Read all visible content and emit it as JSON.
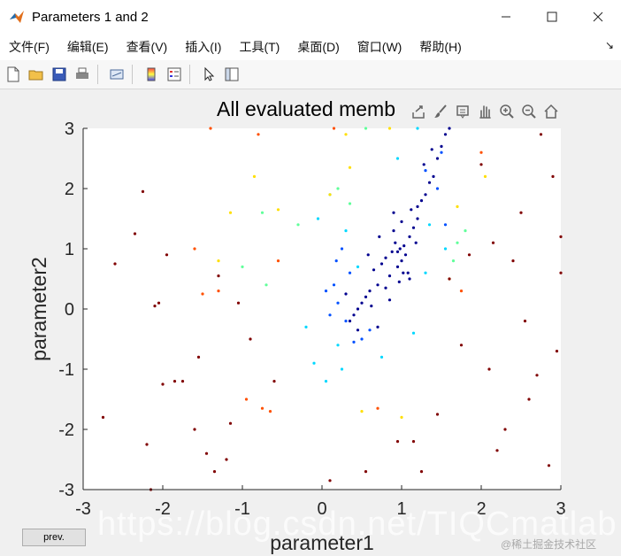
{
  "window": {
    "title": "Parameters 1 and 2",
    "buttons": [
      "minimize",
      "maximize",
      "close"
    ]
  },
  "menubar": {
    "items": [
      "文件(F)",
      "编辑(E)",
      "查看(V)",
      "插入(I)",
      "工具(T)",
      "桌面(D)",
      "窗口(W)",
      "帮助(H)"
    ],
    "overflow": "↘"
  },
  "toolbar": {
    "icons": [
      "new-figure-icon",
      "open-file-icon",
      "save-icon",
      "print-icon",
      "link-plot-icon",
      "colorbar-icon",
      "legend-icon",
      "pointer-icon",
      "property-inspector-icon"
    ]
  },
  "axes_toolbar": {
    "icons": [
      "export-icon",
      "brush-icon",
      "data-tips-icon",
      "pan-icon",
      "zoom-in-icon",
      "zoom-out-icon",
      "home-icon"
    ]
  },
  "controls": {
    "prev_label": "prev."
  },
  "watermark": {
    "main": "https://blog.csdn.net/TIQCmatlab",
    "corner": "@稀土掘金技术社区"
  },
  "colors": {
    "plot_bg": "#ffffff",
    "figure_bg": "#f0f0f0",
    "dense": "#00008f",
    "outer": "#800000"
  },
  "chart_data": {
    "type": "scatter",
    "title": "All evaluated memb",
    "xlabel": "parameter1",
    "ylabel": "parameter2",
    "xlim": [
      -3,
      3
    ],
    "ylim": [
      -3,
      3
    ],
    "xticks": [
      "-3",
      "-2",
      "-1",
      "0",
      "1",
      "2",
      "3"
    ],
    "yticks": [
      "-3",
      "-2",
      "-1",
      "0",
      "1",
      "2",
      "3"
    ],
    "grid": false,
    "colormap": "jet",
    "points_note": "",
    "series": [
      {
        "color": "#00008f",
        "x": [
          0.98,
          1.05,
          1.1,
          0.92,
          1.0,
          0.88,
          1.15,
          0.95,
          1.2,
          0.8,
          1.03,
          0.9,
          1.08,
          0.85,
          1.12,
          0.97,
          0.75,
          1.25,
          0.7,
          1.3,
          0.6,
          1.35,
          0.55,
          0.5,
          0.45,
          0.4,
          1.4,
          1.45,
          0.65,
          1.0,
          0.9,
          1.1,
          0.8,
          1.2,
          0.72,
          1.18,
          0.58,
          0.35,
          0.3,
          0.45,
          0.62,
          0.7,
          0.85,
          1.5,
          1.55,
          1.6,
          1.28,
          1.38,
          0.95,
          1.02
        ],
        "y": [
          1.0,
          0.9,
          1.2,
          1.1,
          0.8,
          0.95,
          1.35,
          0.7,
          1.5,
          0.85,
          1.05,
          1.3,
          0.6,
          0.55,
          1.65,
          0.45,
          0.75,
          1.8,
          0.4,
          1.9,
          0.3,
          2.1,
          0.2,
          0.1,
          0.0,
          -0.1,
          2.2,
          2.5,
          0.65,
          1.45,
          1.6,
          0.5,
          0.35,
          1.7,
          1.2,
          1.1,
          0.9,
          -0.2,
          0.25,
          -0.35,
          0.05,
          -0.3,
          0.15,
          2.7,
          2.9,
          3.0,
          2.4,
          2.65,
          0.95,
          0.6
        ]
      },
      {
        "color": "#0050ff",
        "x": [
          0.2,
          0.3,
          0.15,
          0.35,
          0.5,
          0.1,
          0.25,
          1.3,
          1.45,
          1.5,
          0.05,
          0.4,
          0.18,
          0.6,
          1.55
        ],
        "y": [
          0.1,
          -0.2,
          0.4,
          0.6,
          -0.5,
          -0.1,
          1.0,
          2.3,
          2.0,
          2.6,
          0.3,
          -0.55,
          0.8,
          -0.35,
          1.4
        ]
      },
      {
        "color": "#00d8ff",
        "x": [
          -0.1,
          0.05,
          0.2,
          0.3,
          -0.2,
          0.1,
          0.75,
          1.2,
          1.35,
          1.55,
          0.95,
          0.45,
          0.25,
          1.15,
          1.3,
          -0.05
        ],
        "y": [
          -0.9,
          -1.2,
          -0.6,
          1.3,
          -0.3,
          1.9,
          -0.8,
          3.0,
          1.4,
          1.0,
          2.5,
          0.7,
          -1.0,
          -0.4,
          0.6,
          1.5
        ]
      },
      {
        "color": "#60ff9a",
        "x": [
          -1.0,
          -0.7,
          -0.75,
          0.35,
          0.55,
          -0.3,
          1.7,
          0.2,
          1.8,
          1.65
        ],
        "y": [
          0.7,
          0.4,
          1.6,
          1.75,
          3.0,
          1.4,
          1.1,
          2.0,
          1.3,
          0.8
        ]
      },
      {
        "color": "#ffdf00",
        "x": [
          -1.15,
          -0.85,
          -0.55,
          0.1,
          0.35,
          0.85,
          1.6,
          1.7,
          0.5,
          2.05,
          1.0,
          -1.3,
          0.3
        ],
        "y": [
          1.6,
          2.2,
          1.65,
          1.9,
          2.35,
          3.0,
          0.5,
          1.7,
          -1.7,
          2.2,
          -1.8,
          0.8,
          2.9
        ]
      },
      {
        "color": "#ff5000",
        "x": [
          -1.5,
          -1.6,
          -1.3,
          -0.95,
          -0.75,
          -0.65,
          0.15,
          0.7,
          2.0,
          1.75,
          -1.4,
          -0.8,
          -0.55
        ],
        "y": [
          0.25,
          1.0,
          0.3,
          -1.5,
          -1.65,
          -1.7,
          3.0,
          -1.65,
          2.6,
          0.3,
          3.0,
          2.9,
          0.8
        ]
      },
      {
        "color": "#800000",
        "x": [
          -2.75,
          -2.2,
          -2.15,
          -2.1,
          -2.05,
          -2.0,
          -1.85,
          -1.6,
          -1.55,
          -1.45,
          -1.35,
          -1.2,
          -1.15,
          -1.05,
          -0.9,
          -0.6,
          0.1,
          0.55,
          0.95,
          1.15,
          1.25,
          1.45,
          1.75,
          2.0,
          2.15,
          2.3,
          2.55,
          2.7,
          2.9,
          3.0,
          3.0,
          2.95,
          2.85,
          2.6,
          2.4,
          2.2,
          -2.6,
          -2.25,
          -2.35,
          -1.95,
          -1.75,
          -1.3,
          2.1,
          2.5,
          2.75,
          1.85,
          1.6
        ],
        "y": [
          -1.8,
          -2.25,
          -3.0,
          0.05,
          0.1,
          -1.25,
          -1.2,
          -2.0,
          -0.8,
          -2.4,
          -2.7,
          -2.5,
          -1.9,
          0.1,
          -0.5,
          -1.2,
          -2.85,
          -2.7,
          -2.2,
          -2.2,
          -2.7,
          -1.75,
          -0.6,
          2.4,
          1.1,
          -2.0,
          -0.2,
          -1.1,
          2.2,
          1.2,
          0.6,
          -0.7,
          -2.6,
          -1.5,
          0.8,
          -2.35,
          0.75,
          1.95,
          1.25,
          0.9,
          -1.2,
          0.55,
          -1.0,
          1.6,
          2.9,
          0.9,
          0.5
        ]
      }
    ]
  }
}
